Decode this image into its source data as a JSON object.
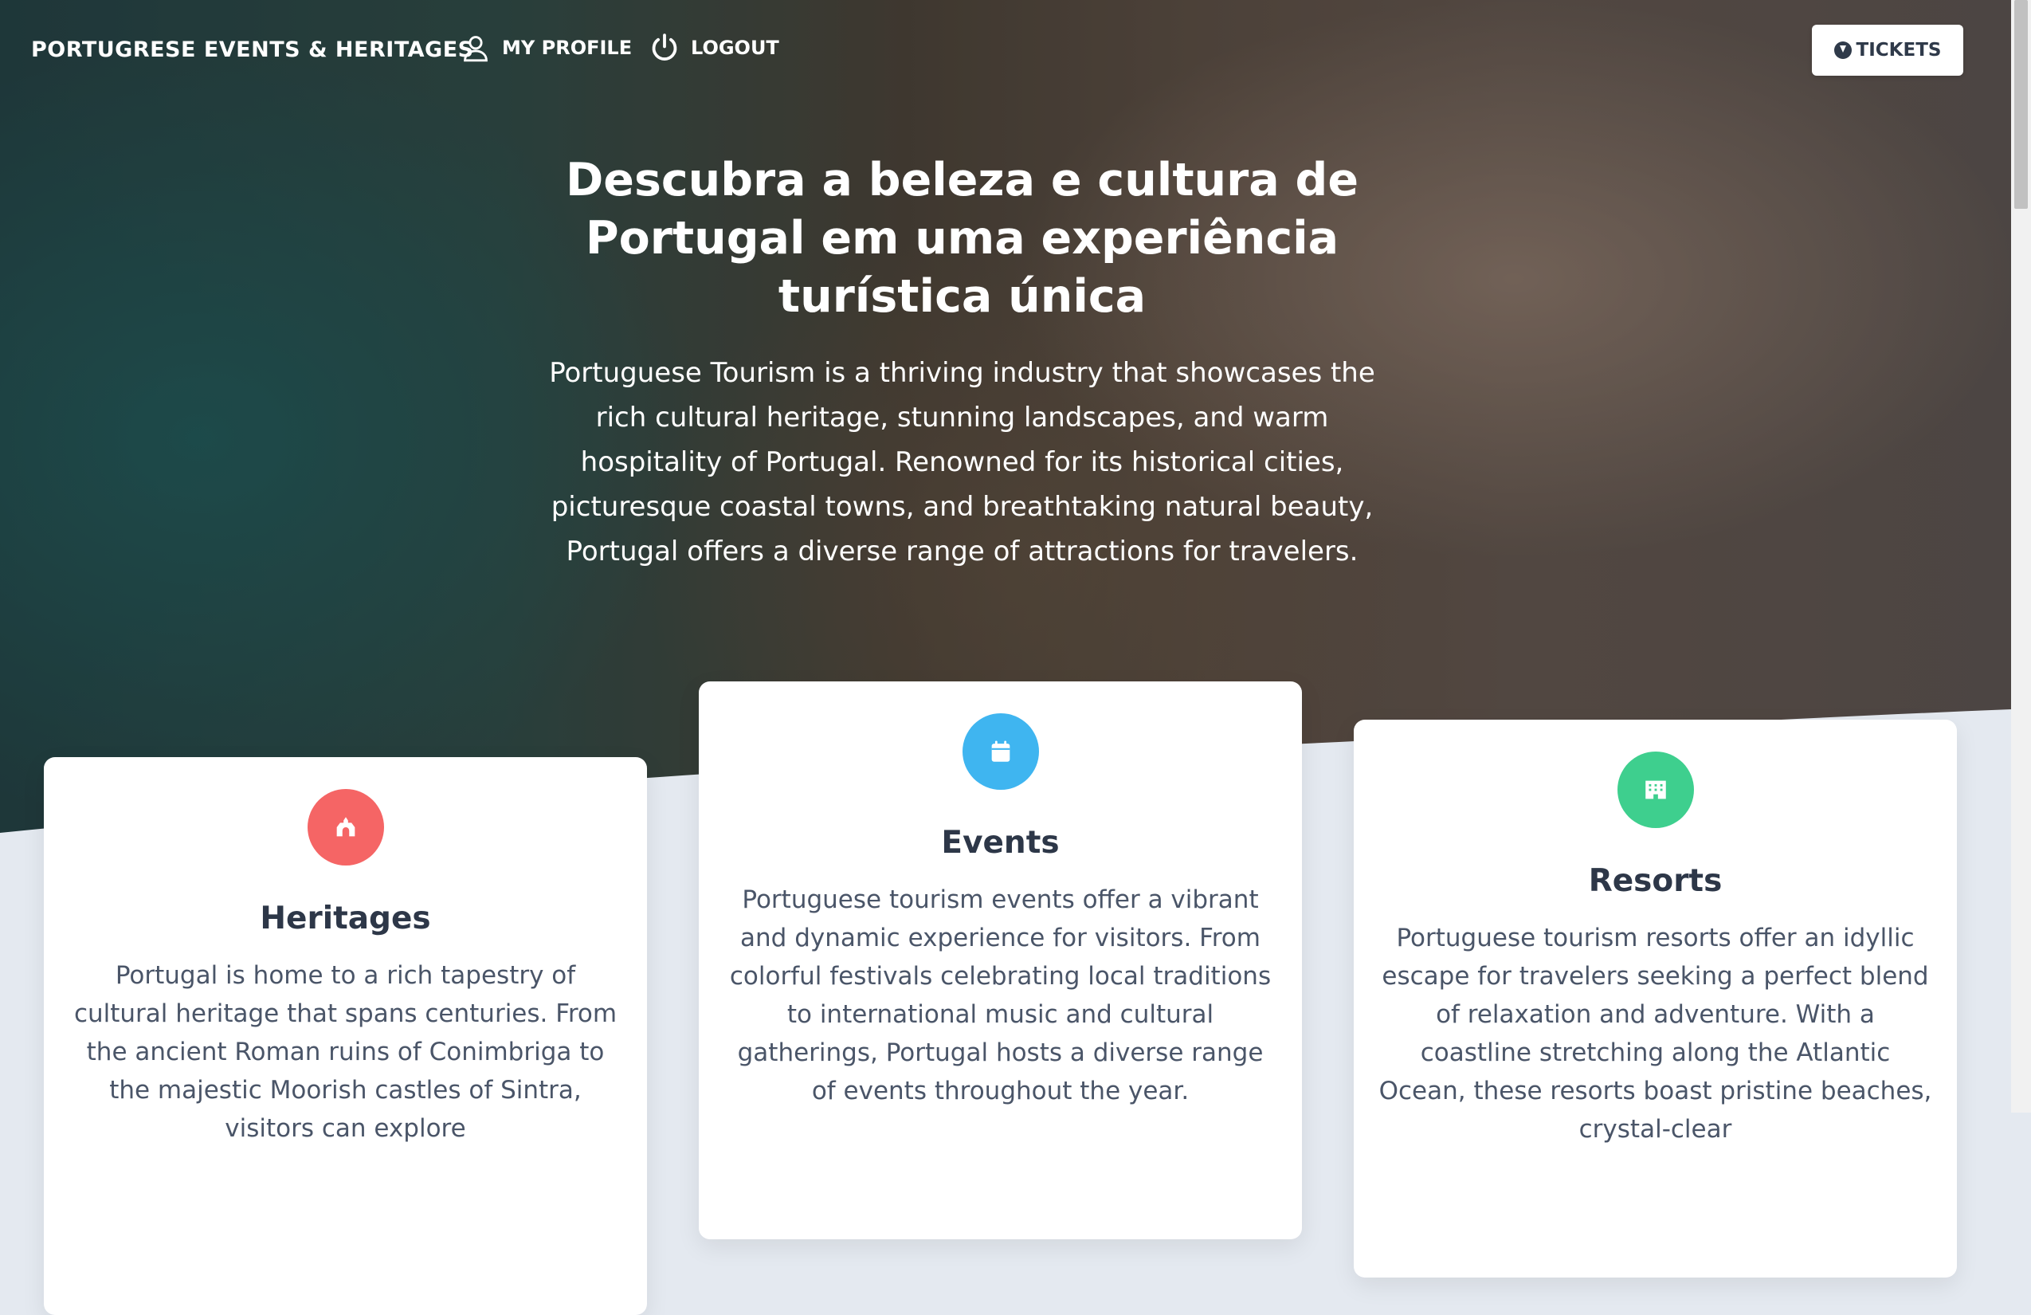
{
  "nav": {
    "brand": "PORTUGRESE EVENTS & HERITAGES",
    "profile_label": "MY PROFILE",
    "logout_label": "LOGOUT",
    "tickets_label": "TICKETS"
  },
  "hero": {
    "title": "Descubra a beleza e cultura de Portugal em uma experiência turística única",
    "text": "Portuguese Tourism is a thriving industry that showcases the rich cultural heritage, stunning landscapes, and warm hospitality of Portugal. Renowned for its historical cities, picturesque coastal towns, and breathtaking natural beauty, Portugal offers a diverse range of attractions for travelers."
  },
  "cards": [
    {
      "title": "Heritages",
      "icon": "landmark-icon",
      "color": "#f56565",
      "text": "Portugal is home to a rich tapestry of cultural heritage that spans centuries. From the ancient Roman ruins of Conimbriga to the majestic Moorish castles of Sintra, visitors can explore"
    },
    {
      "title": "Events",
      "icon": "calendar-icon",
      "color": "#3fb5f0",
      "text": "Portuguese tourism events offer a vibrant and dynamic experience for visitors. From colorful festivals celebrating local traditions to international music and cultural gatherings, Portugal hosts a diverse range of events throughout the year."
    },
    {
      "title": "Resorts",
      "icon": "building-icon",
      "color": "#3ecf8e",
      "text": "Portuguese tourism resorts offer an idyllic escape for travelers seeking a perfect blend of relaxation and adventure. With a coastline stretching along the Atlantic Ocean, these resorts boast pristine beaches, crystal-clear"
    }
  ]
}
